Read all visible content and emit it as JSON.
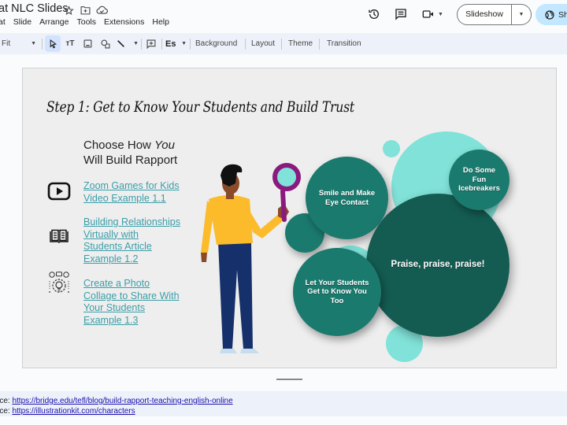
{
  "app": {
    "doc_title": "at NLC Slides",
    "title_icons": [
      "star-icon",
      "move-to-folder-icon",
      "cloud-saved-icon"
    ],
    "menu": [
      "at",
      "Slide",
      "Arrange",
      "Tools",
      "Extensions",
      "Help"
    ],
    "right_actions": {
      "history_icon": "version-history-icon",
      "comments_icon": "comments-icon",
      "meet_icon": "video-call-icon",
      "slideshow_label": "Slideshow",
      "share_label": "Sh"
    }
  },
  "toolbar": {
    "zoom_value": "Fit",
    "tools": [
      "select",
      "text-box",
      "image",
      "shape",
      "line",
      "comment",
      "input-tools"
    ],
    "buttons": [
      "Background",
      "Layout",
      "Theme",
      "Transition"
    ],
    "input_tools_label": "Es"
  },
  "slide": {
    "title": "Step 1: Get to Know Your Students and Build Trust",
    "subtitle_line1_prefix": "Choose How ",
    "subtitle_line1_em": "You",
    "subtitle_line2": "Will Build Rapport",
    "resources": [
      {
        "icon": "video-play-icon",
        "lines": [
          "Zoom Games for Kids",
          "Video Example 1.1"
        ]
      },
      {
        "icon": "open-book-icon",
        "lines": [
          "Building Relationships",
          "Virtually with",
          "Students Article",
          "Example 1.2"
        ]
      },
      {
        "icon": "idea-gear-icon",
        "lines": [
          "Create a Photo",
          "Collage to Share With",
          "Your Students",
          "Example 1.3"
        ]
      }
    ],
    "bubbles": {
      "smile": "Smile and Make Eye Contact",
      "icebreakers": "Do Some Fun Icebreakers",
      "praise": "Praise, praise, praise!",
      "let_know": "Let Your Students Get to Know You Too"
    },
    "colors": {
      "bubble_light": "#80e2d8",
      "bubble_mid": "#1b7a6e",
      "bubble_dark": "#145c52",
      "link": "#3a9ea8",
      "shirt": "#fbbb2a",
      "pants": "#15306a",
      "magnifier": "#8a1a7e"
    }
  },
  "notes": [
    {
      "prefix": "rce: ",
      "link": "https://bridge.edu/tefl/blog/build-rapport-teaching-english-online"
    },
    {
      "prefix": "rce: ",
      "link": "https://illustrationkit.com/characters"
    }
  ]
}
